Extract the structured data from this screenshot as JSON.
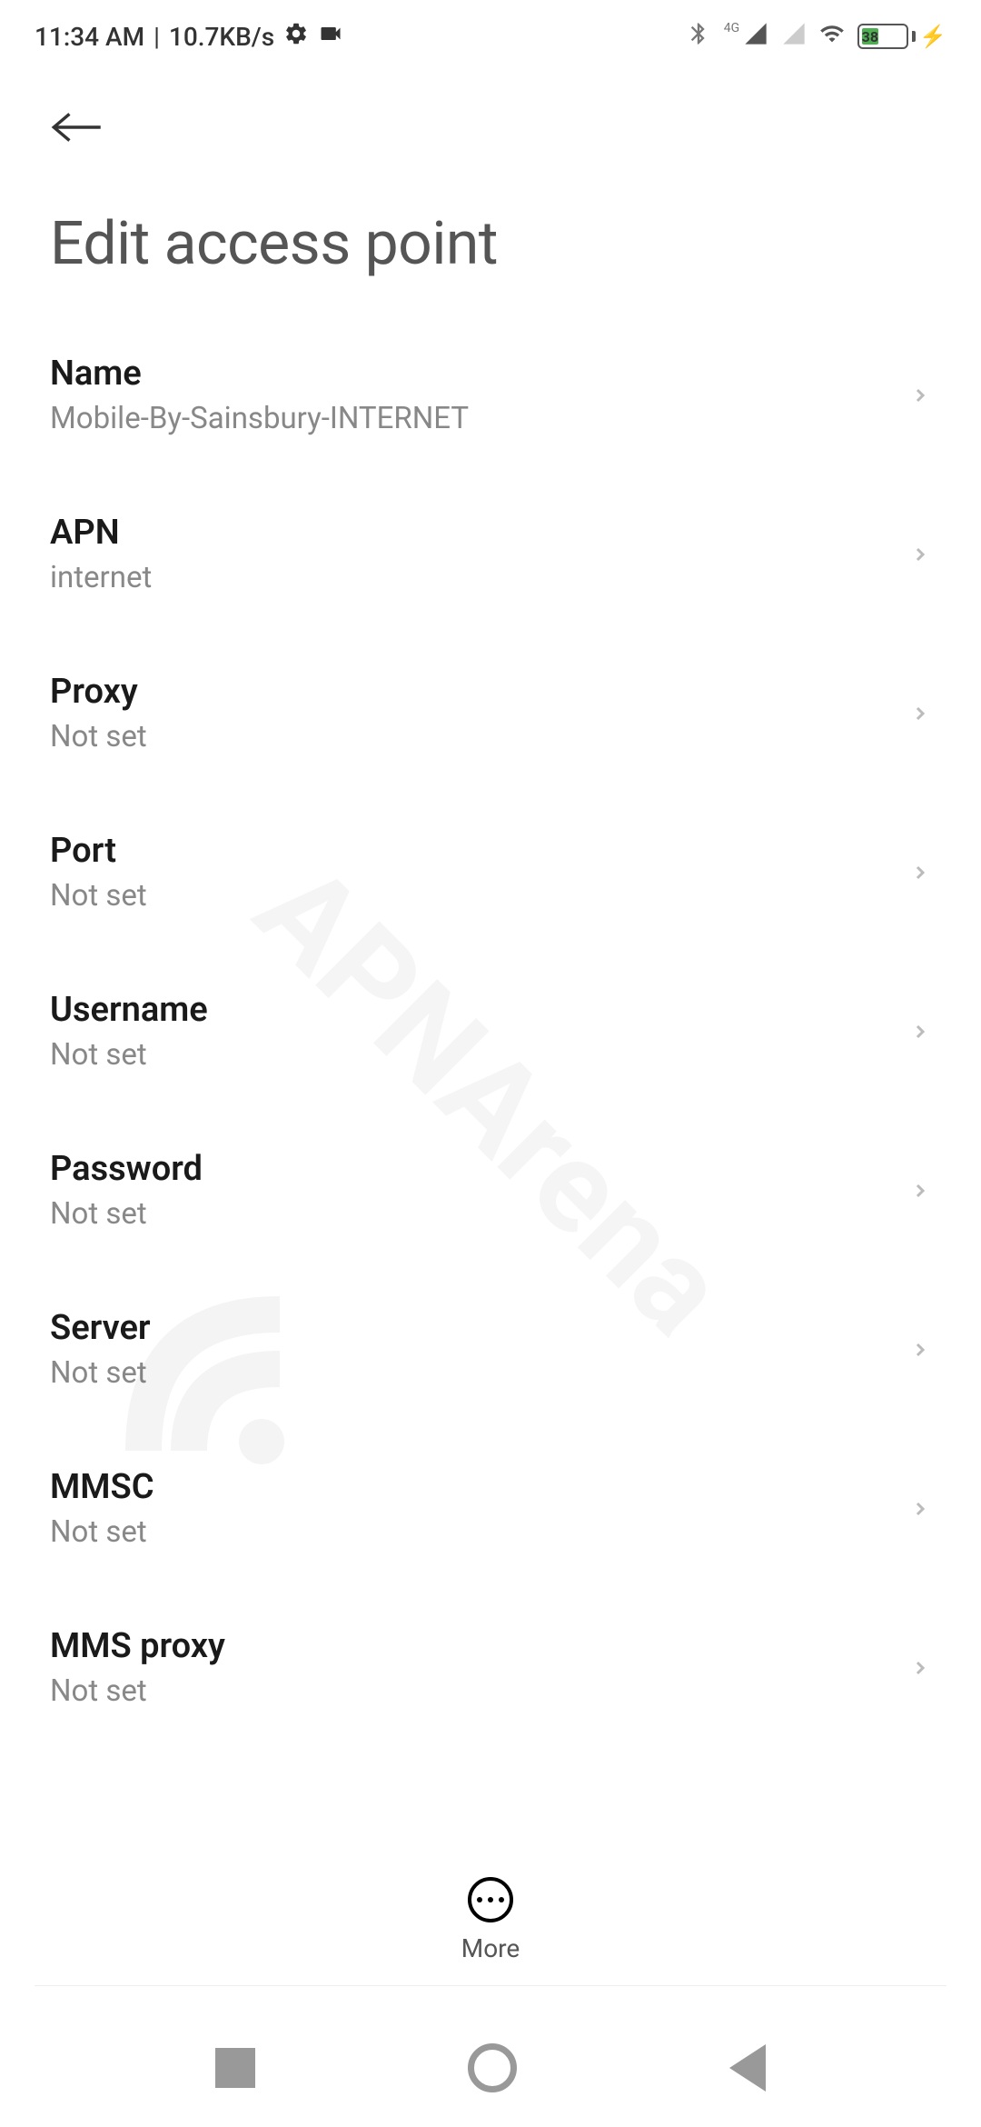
{
  "status": {
    "time": "11:34 AM",
    "data_rate": "10.7KB/s",
    "network_type": "4G",
    "battery_percent": "38"
  },
  "page": {
    "title": "Edit access point"
  },
  "settings": [
    {
      "label": "Name",
      "value": "Mobile-By-Sainsbury-INTERNET"
    },
    {
      "label": "APN",
      "value": "internet"
    },
    {
      "label": "Proxy",
      "value": "Not set"
    },
    {
      "label": "Port",
      "value": "Not set"
    },
    {
      "label": "Username",
      "value": "Not set"
    },
    {
      "label": "Password",
      "value": "Not set"
    },
    {
      "label": "Server",
      "value": "Not set"
    },
    {
      "label": "MMSC",
      "value": "Not set"
    },
    {
      "label": "MMS proxy",
      "value": "Not set"
    }
  ],
  "bottom": {
    "more_label": "More"
  },
  "watermark": "APNArena"
}
